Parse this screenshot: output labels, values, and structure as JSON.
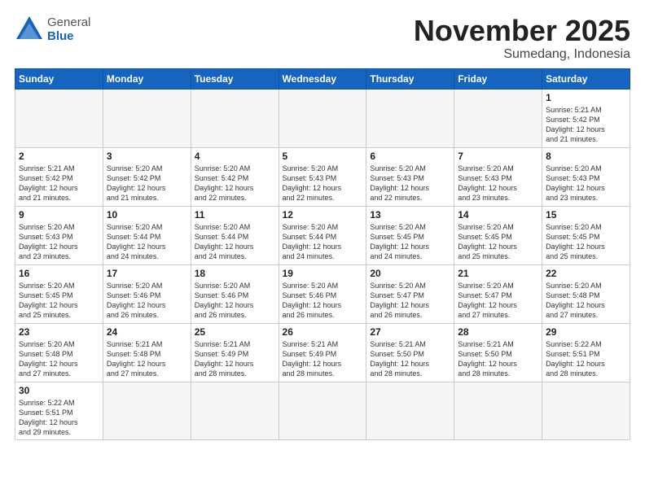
{
  "logo": {
    "text_general": "General",
    "text_blue": "Blue"
  },
  "header": {
    "month_title": "November 2025",
    "location": "Sumedang, Indonesia"
  },
  "weekdays": [
    "Sunday",
    "Monday",
    "Tuesday",
    "Wednesday",
    "Thursday",
    "Friday",
    "Saturday"
  ],
  "days": [
    {
      "date": "",
      "info": ""
    },
    {
      "date": "",
      "info": ""
    },
    {
      "date": "",
      "info": ""
    },
    {
      "date": "",
      "info": ""
    },
    {
      "date": "",
      "info": ""
    },
    {
      "date": "",
      "info": ""
    },
    {
      "date": "1",
      "info": "Sunrise: 5:21 AM\nSunset: 5:42 PM\nDaylight: 12 hours\nand 21 minutes."
    },
    {
      "date": "2",
      "info": "Sunrise: 5:21 AM\nSunset: 5:42 PM\nDaylight: 12 hours\nand 21 minutes."
    },
    {
      "date": "3",
      "info": "Sunrise: 5:20 AM\nSunset: 5:42 PM\nDaylight: 12 hours\nand 21 minutes."
    },
    {
      "date": "4",
      "info": "Sunrise: 5:20 AM\nSunset: 5:42 PM\nDaylight: 12 hours\nand 22 minutes."
    },
    {
      "date": "5",
      "info": "Sunrise: 5:20 AM\nSunset: 5:43 PM\nDaylight: 12 hours\nand 22 minutes."
    },
    {
      "date": "6",
      "info": "Sunrise: 5:20 AM\nSunset: 5:43 PM\nDaylight: 12 hours\nand 22 minutes."
    },
    {
      "date": "7",
      "info": "Sunrise: 5:20 AM\nSunset: 5:43 PM\nDaylight: 12 hours\nand 23 minutes."
    },
    {
      "date": "8",
      "info": "Sunrise: 5:20 AM\nSunset: 5:43 PM\nDaylight: 12 hours\nand 23 minutes."
    },
    {
      "date": "9",
      "info": "Sunrise: 5:20 AM\nSunset: 5:43 PM\nDaylight: 12 hours\nand 23 minutes."
    },
    {
      "date": "10",
      "info": "Sunrise: 5:20 AM\nSunset: 5:44 PM\nDaylight: 12 hours\nand 24 minutes."
    },
    {
      "date": "11",
      "info": "Sunrise: 5:20 AM\nSunset: 5:44 PM\nDaylight: 12 hours\nand 24 minutes."
    },
    {
      "date": "12",
      "info": "Sunrise: 5:20 AM\nSunset: 5:44 PM\nDaylight: 12 hours\nand 24 minutes."
    },
    {
      "date": "13",
      "info": "Sunrise: 5:20 AM\nSunset: 5:45 PM\nDaylight: 12 hours\nand 24 minutes."
    },
    {
      "date": "14",
      "info": "Sunrise: 5:20 AM\nSunset: 5:45 PM\nDaylight: 12 hours\nand 25 minutes."
    },
    {
      "date": "15",
      "info": "Sunrise: 5:20 AM\nSunset: 5:45 PM\nDaylight: 12 hours\nand 25 minutes."
    },
    {
      "date": "16",
      "info": "Sunrise: 5:20 AM\nSunset: 5:45 PM\nDaylight: 12 hours\nand 25 minutes."
    },
    {
      "date": "17",
      "info": "Sunrise: 5:20 AM\nSunset: 5:46 PM\nDaylight: 12 hours\nand 26 minutes."
    },
    {
      "date": "18",
      "info": "Sunrise: 5:20 AM\nSunset: 5:46 PM\nDaylight: 12 hours\nand 26 minutes."
    },
    {
      "date": "19",
      "info": "Sunrise: 5:20 AM\nSunset: 5:46 PM\nDaylight: 12 hours\nand 26 minutes."
    },
    {
      "date": "20",
      "info": "Sunrise: 5:20 AM\nSunset: 5:47 PM\nDaylight: 12 hours\nand 26 minutes."
    },
    {
      "date": "21",
      "info": "Sunrise: 5:20 AM\nSunset: 5:47 PM\nDaylight: 12 hours\nand 27 minutes."
    },
    {
      "date": "22",
      "info": "Sunrise: 5:20 AM\nSunset: 5:48 PM\nDaylight: 12 hours\nand 27 minutes."
    },
    {
      "date": "23",
      "info": "Sunrise: 5:20 AM\nSunset: 5:48 PM\nDaylight: 12 hours\nand 27 minutes."
    },
    {
      "date": "24",
      "info": "Sunrise: 5:21 AM\nSunset: 5:48 PM\nDaylight: 12 hours\nand 27 minutes."
    },
    {
      "date": "25",
      "info": "Sunrise: 5:21 AM\nSunset: 5:49 PM\nDaylight: 12 hours\nand 28 minutes."
    },
    {
      "date": "26",
      "info": "Sunrise: 5:21 AM\nSunset: 5:49 PM\nDaylight: 12 hours\nand 28 minutes."
    },
    {
      "date": "27",
      "info": "Sunrise: 5:21 AM\nSunset: 5:50 PM\nDaylight: 12 hours\nand 28 minutes."
    },
    {
      "date": "28",
      "info": "Sunrise: 5:21 AM\nSunset: 5:50 PM\nDaylight: 12 hours\nand 28 minutes."
    },
    {
      "date": "29",
      "info": "Sunrise: 5:22 AM\nSunset: 5:51 PM\nDaylight: 12 hours\nand 28 minutes."
    },
    {
      "date": "30",
      "info": "Sunrise: 5:22 AM\nSunset: 5:51 PM\nDaylight: 12 hours\nand 29 minutes."
    },
    {
      "date": "",
      "info": ""
    },
    {
      "date": "",
      "info": ""
    },
    {
      "date": "",
      "info": ""
    },
    {
      "date": "",
      "info": ""
    },
    {
      "date": "",
      "info": ""
    },
    {
      "date": "",
      "info": ""
    }
  ]
}
